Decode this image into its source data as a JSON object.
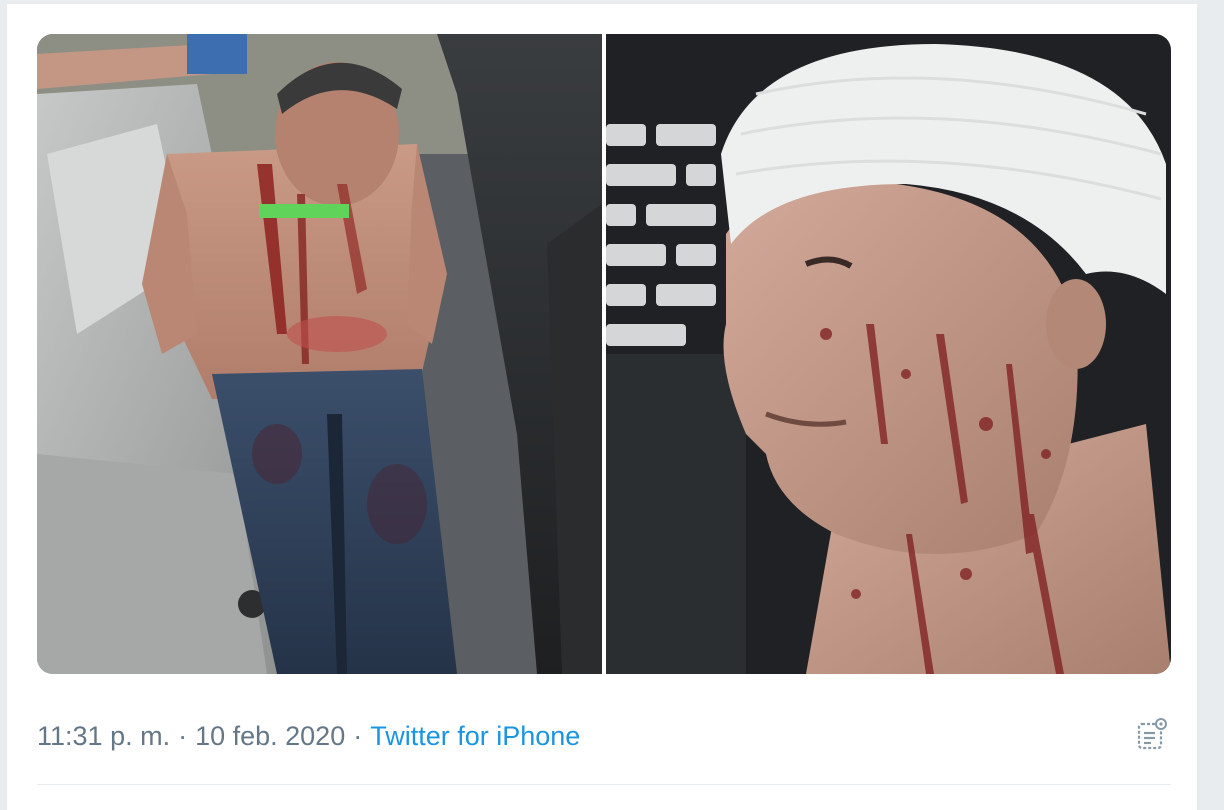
{
  "tweet": {
    "time": "11:31 p. m.",
    "separator": "·",
    "date": "10 feb. 2020",
    "source": "Twitter for iPhone"
  },
  "media": {
    "photo_count": 2
  },
  "icons": {
    "analytics": "analytics-icon"
  },
  "colors": {
    "meta_text": "#657786",
    "source_link": "#1b95e0",
    "divider": "#e6ecf0"
  }
}
